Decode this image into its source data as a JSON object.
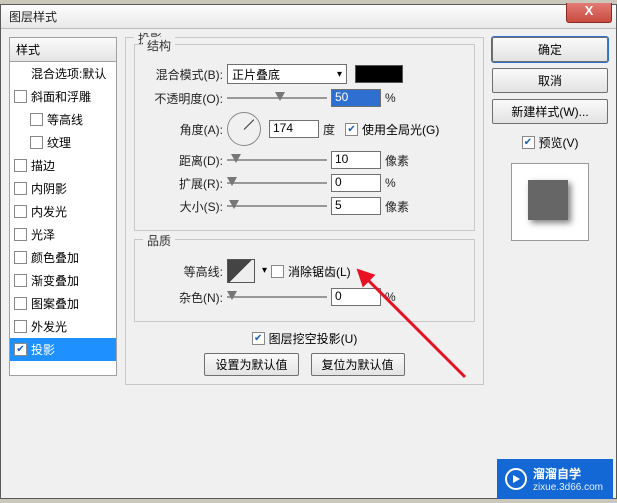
{
  "window": {
    "title": "图层样式"
  },
  "close": "X",
  "stylesHeader": "样式",
  "blendDefault": "混合选项:默认",
  "styles": [
    {
      "label": "斜面和浮雕",
      "checked": false,
      "indent": 0
    },
    {
      "label": "等高线",
      "checked": false,
      "indent": 1
    },
    {
      "label": "纹理",
      "checked": false,
      "indent": 1
    },
    {
      "label": "描边",
      "checked": false,
      "indent": 0
    },
    {
      "label": "内阴影",
      "checked": false,
      "indent": 0
    },
    {
      "label": "内发光",
      "checked": false,
      "indent": 0
    },
    {
      "label": "光泽",
      "checked": false,
      "indent": 0
    },
    {
      "label": "颜色叠加",
      "checked": false,
      "indent": 0
    },
    {
      "label": "渐变叠加",
      "checked": false,
      "indent": 0
    },
    {
      "label": "图案叠加",
      "checked": false,
      "indent": 0
    },
    {
      "label": "外发光",
      "checked": false,
      "indent": 0
    },
    {
      "label": "投影",
      "checked": true,
      "indent": 0,
      "selected": true
    }
  ],
  "groups": {
    "dropShadow": "投影",
    "structure": "结构",
    "quality": "品质"
  },
  "fields": {
    "blendMode": {
      "label": "混合模式(B):",
      "value": "正片叠底"
    },
    "opacity": {
      "label": "不透明度(O):",
      "value": "50",
      "unit": "%"
    },
    "angle": {
      "label": "角度(A):",
      "value": "174",
      "unit": "度"
    },
    "useGlobal": {
      "label": "使用全局光(G)",
      "checked": true
    },
    "distance": {
      "label": "距离(D):",
      "value": "10",
      "unit": "像素"
    },
    "spread": {
      "label": "扩展(R):",
      "value": "0",
      "unit": "%"
    },
    "size": {
      "label": "大小(S):",
      "value": "5",
      "unit": "像素"
    },
    "contour": {
      "label": "等高线:"
    },
    "antiAlias": {
      "label": "消除锯齿(L)",
      "checked": false
    },
    "noise": {
      "label": "杂色(N):",
      "value": "0",
      "unit": "%"
    },
    "knockout": {
      "label": "图层挖空投影(U)",
      "checked": true
    }
  },
  "buttons": {
    "setDefault": "设置为默认值",
    "resetDefault": "复位为默认值",
    "ok": "确定",
    "cancel": "取消",
    "newStyle": "新建样式(W)...",
    "preview": "预览(V)"
  },
  "watermark": {
    "main": "溜溜自学",
    "sub": "zixue.3d66.com"
  }
}
